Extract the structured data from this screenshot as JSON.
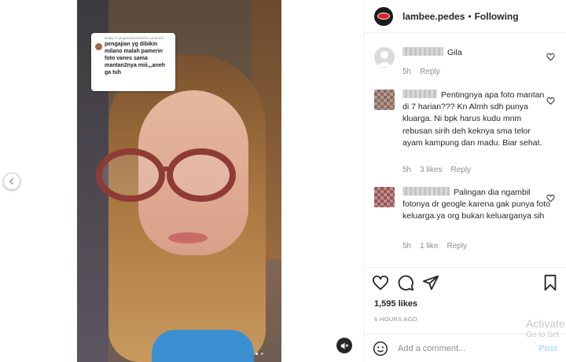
{
  "post": {
    "username": "lambee.pedes",
    "separator": "•",
    "follow_status": "Following",
    "likes": "1,595 likes",
    "timestamp": "6 HOURS AGO"
  },
  "video_overlay": {
    "reply_to": "Reply to jangandicori0234's comment",
    "comment_text": "pengajian yg dibikin milano malah pamerin foto vanes sama mantan2nya miii,,,aneh ga tuh"
  },
  "comments": [
    {
      "text": "Gila",
      "time": "5h",
      "likes": "",
      "reply_label": "Reply"
    },
    {
      "text": "Pentingnya apa foto mantan di 7 harian??? Kn Almh sdh punya kluarga. Ni bpk harus kudu mnm rebusan sirih deh keknya sma telor ayam kampung dan madu. Biar sehat.",
      "time": "5h",
      "likes": "3 likes",
      "reply_label": "Reply"
    },
    {
      "text": "Palingan dia ngambil fotonya dr geogle.karena gak punya foto keluarga.ya org bukan keluarganya sih",
      "time": "5h",
      "likes": "1 like",
      "reply_label": "Reply"
    }
  ],
  "add_comment": {
    "placeholder": "Add a comment...",
    "post_label": "Post"
  },
  "watermark": {
    "line1": "Activate",
    "line2": "Go to Set"
  },
  "icons": [
    "chevron-left-icon",
    "speaker-muted-icon",
    "heart-icon",
    "comment-icon",
    "share-icon",
    "bookmark-icon",
    "emoji-icon"
  ],
  "colors": {
    "brand_avatar_bg": "#1a1a1a",
    "brand_lips": "#e0202a",
    "post_disabled": "#b2dffc",
    "muted_text": "#8e8e8e"
  }
}
